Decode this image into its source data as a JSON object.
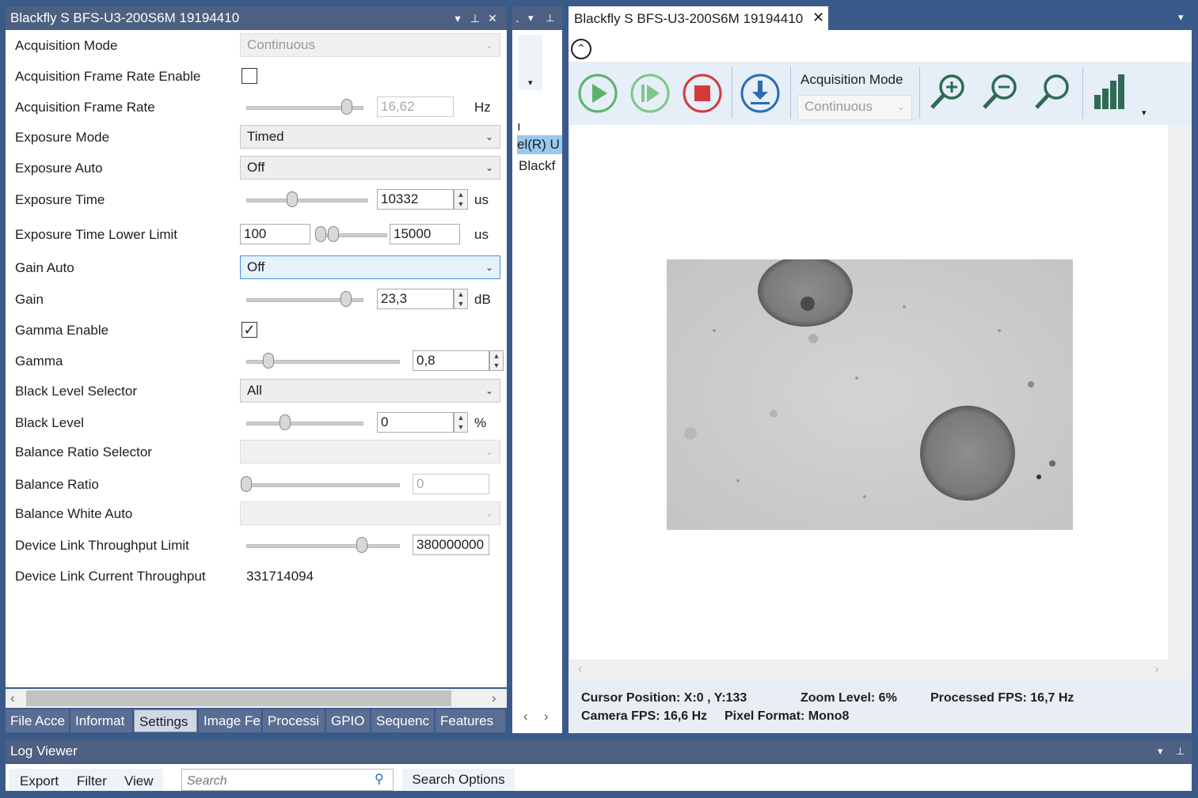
{
  "left_panel": {
    "title": "Blackfly S BFS-U3-200S6M 19194410",
    "rows": {
      "acq_mode": {
        "label": "Acquisition Mode",
        "value": "Continuous"
      },
      "acq_fr_enable": {
        "label": "Acquisition Frame Rate Enable"
      },
      "acq_fr": {
        "label": "Acquisition Frame Rate",
        "value": "16,62",
        "unit": "Hz"
      },
      "exp_mode": {
        "label": "Exposure Mode",
        "value": "Timed"
      },
      "exp_auto": {
        "label": "Exposure Auto",
        "value": "Off"
      },
      "exp_time": {
        "label": "Exposure Time",
        "value": "10332",
        "unit": "us"
      },
      "exp_lower": {
        "label": "Exposure Time Lower Limit",
        "low": "100",
        "high": "15000",
        "unit": "us"
      },
      "gain_auto": {
        "label": "Gain Auto",
        "value": "Off"
      },
      "gain": {
        "label": "Gain",
        "value": "23,3",
        "unit": "dB"
      },
      "gamma_enable": {
        "label": "Gamma Enable",
        "checked": true
      },
      "gamma": {
        "label": "Gamma",
        "value": "0,8"
      },
      "bl_selector": {
        "label": "Black Level Selector",
        "value": "All"
      },
      "black_level": {
        "label": "Black Level",
        "value": "0",
        "unit": "%"
      },
      "bal_selector": {
        "label": "Balance Ratio Selector",
        "value": ""
      },
      "bal_ratio": {
        "label": "Balance Ratio",
        "value": "0"
      },
      "bal_white": {
        "label": "Balance White Auto",
        "value": ""
      },
      "link_limit": {
        "label": "Device Link Throughput Limit",
        "value": "380000000"
      },
      "link_current": {
        "label": "Device Link Current Throughput",
        "value": "331714094"
      }
    },
    "tabs": [
      "File Acce",
      "Informat",
      "Settings",
      "Image Fe",
      "Processi",
      "GPIO",
      "Sequenc",
      "Features"
    ]
  },
  "mid_panel": {
    "title": ".",
    "line1": "ı",
    "line2": "el(R) U",
    "line3": "Blackf"
  },
  "right_panel": {
    "tab_title": "Blackfly S BFS-U3-200S6M 19194410",
    "acq_mode_label": "Acquisition Mode",
    "acq_mode_value": "Continuous",
    "status": {
      "cursor": "Cursor Position: X:0 , Y:133",
      "zoom": "Zoom Level: 6%",
      "processed_fps": "Processed FPS: 16,7 Hz",
      "camera_fps": "Camera FPS: 16,6 Hz",
      "pixel_format": "Pixel Format: Mono8"
    }
  },
  "log_viewer": {
    "title": "Log Viewer",
    "menu": [
      "Export",
      "Filter",
      "View"
    ],
    "search_placeholder": "Search",
    "search_options": "Search Options"
  }
}
